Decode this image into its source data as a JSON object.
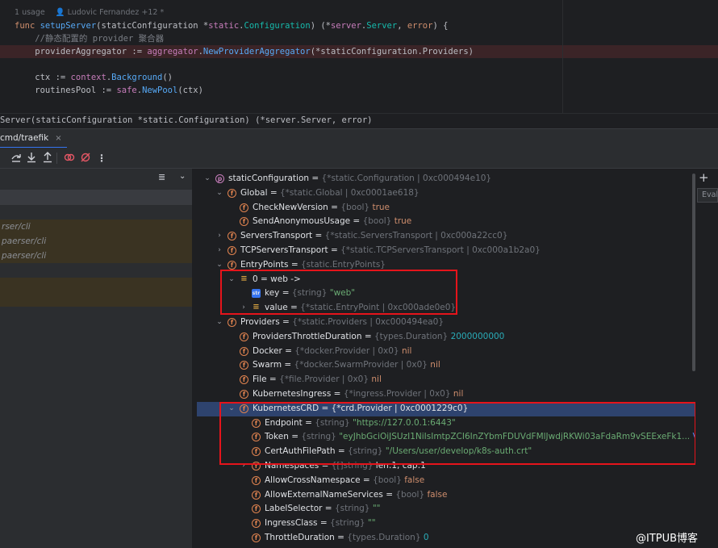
{
  "editor": {
    "hint_usage": "1 usage",
    "hint_author": "Ludovic Fernandez +12 *",
    "lines": [
      {
        "parts": [
          [
            "kw",
            "func "
          ],
          [
            "fn",
            "setupServer"
          ],
          [
            "pk",
            "(staticConfiguration *"
          ],
          [
            "pkg",
            "static"
          ],
          [
            "pk",
            "."
          ],
          [
            "ty",
            "Configuration"
          ],
          [
            "pk",
            ") (*"
          ],
          [
            "pkg",
            "server"
          ],
          [
            "pk",
            "."
          ],
          [
            "ty",
            "Server"
          ],
          [
            "pk",
            ", "
          ],
          [
            "kw",
            "error"
          ],
          [
            "pk",
            ") {"
          ]
        ]
      },
      {
        "parts": [
          [
            "cm",
            "    //静态配置的 provider 聚合器"
          ]
        ]
      },
      {
        "parts": [
          [
            "pk",
            "    providerAggregator := "
          ],
          [
            "pkg",
            "aggregator"
          ],
          [
            "pk",
            "."
          ],
          [
            "call",
            "NewProviderAggregator"
          ],
          [
            "pk",
            "(*staticConfiguration.Providers)"
          ]
        ]
      },
      {
        "parts": [
          [
            "pk",
            ""
          ]
        ]
      },
      {
        "parts": [
          [
            "pk",
            "    ctx := "
          ],
          [
            "pkg",
            "context"
          ],
          [
            "pk",
            "."
          ],
          [
            "call",
            "Background"
          ],
          [
            "pk",
            "()"
          ]
        ]
      },
      {
        "parts": [
          [
            "pk",
            "    routinesPool := "
          ],
          [
            "pkg",
            "safe"
          ],
          [
            "pk",
            "."
          ],
          [
            "call",
            "NewPool"
          ],
          [
            "pk",
            "(ctx)"
          ]
        ]
      }
    ]
  },
  "breadcrumb": "Server(staticConfiguration *static.Configuration) (*server.Server, error)",
  "debug_tab": {
    "label": "cmd/traefik",
    "close": "×"
  },
  "toolbar_icons": [
    "step-over-icon",
    "step-into-icon",
    "step-out-icon",
    "view-breakpoints-icon",
    "mute-breakpoints-icon",
    "more-icon"
  ],
  "frames": [
    {
      "label": "rser/cli"
    },
    {
      "label": "paerser/cli"
    },
    {
      "label": "paerser/cli"
    },
    {
      "label": ""
    },
    {
      "label": ""
    }
  ],
  "variables": [
    {
      "indent": 0,
      "arrow": "⌄",
      "icon": "p",
      "name": "staticConfiguration",
      "type": "{*static.Configuration | 0xc000494e10}",
      "value": "",
      "vclass": ""
    },
    {
      "indent": 1,
      "arrow": "⌄",
      "icon": "f",
      "name": "Global",
      "type": "{*static.Global | 0xc0001ae618}",
      "value": "",
      "vclass": ""
    },
    {
      "indent": 2,
      "arrow": "",
      "icon": "f",
      "name": "CheckNewVersion",
      "type": "{bool}",
      "value": "true",
      "vclass": "vkw"
    },
    {
      "indent": 2,
      "arrow": "",
      "icon": "f",
      "name": "SendAnonymousUsage",
      "type": "{bool}",
      "value": "true",
      "vclass": "vkw"
    },
    {
      "indent": 1,
      "arrow": "›",
      "icon": "f",
      "name": "ServersTransport",
      "type": "{*static.ServersTransport | 0xc000a22cc0}",
      "value": "",
      "vclass": ""
    },
    {
      "indent": 1,
      "arrow": "›",
      "icon": "f",
      "name": "TCPServersTransport",
      "type": "{*static.TCPServersTransport | 0xc000a1b2a0}",
      "value": "",
      "vclass": ""
    },
    {
      "indent": 1,
      "arrow": "⌄",
      "icon": "f",
      "name": "EntryPoints",
      "type": "{static.EntryPoints}",
      "value": "",
      "vclass": ""
    },
    {
      "indent": 2,
      "arrow": "⌄",
      "icon": "arr",
      "name": "0 = web ->",
      "type": "",
      "value": "",
      "vclass": "",
      "raw": true
    },
    {
      "indent": 3,
      "arrow": "",
      "icon": "str",
      "name": "key",
      "type": "{string}",
      "value": "\"web\"",
      "vclass": "vstr"
    },
    {
      "indent": 3,
      "arrow": "›",
      "icon": "arr",
      "name": "value",
      "type": "{*static.EntryPoint | 0xc000ade0e0}",
      "value": "",
      "vclass": ""
    },
    {
      "indent": 1,
      "arrow": "⌄",
      "icon": "f",
      "name": "Providers",
      "type": "{*static.Providers | 0xc000494ea0}",
      "value": "",
      "vclass": ""
    },
    {
      "indent": 2,
      "arrow": "",
      "icon": "f",
      "name": "ProvidersThrottleDuration",
      "type": "{types.Duration}",
      "value": "2000000000",
      "vclass": "vnum"
    },
    {
      "indent": 2,
      "arrow": "",
      "icon": "f",
      "name": "Docker",
      "type": "{*docker.Provider | 0x0}",
      "value": "nil",
      "vclass": "vkw"
    },
    {
      "indent": 2,
      "arrow": "",
      "icon": "f",
      "name": "Swarm",
      "type": "{*docker.SwarmProvider | 0x0}",
      "value": "nil",
      "vclass": "vkw"
    },
    {
      "indent": 2,
      "arrow": "",
      "icon": "f",
      "name": "File",
      "type": "{*file.Provider | 0x0}",
      "value": "nil",
      "vclass": "vkw"
    },
    {
      "indent": 2,
      "arrow": "",
      "icon": "f",
      "name": "KubernetesIngress",
      "type": "{*ingress.Provider | 0x0}",
      "value": "nil",
      "vclass": "vkw"
    },
    {
      "indent": 2,
      "arrow": "⌄",
      "icon": "f",
      "name": "KubernetesCRD = {*crd.Provider | 0xc0001229c0}",
      "type": "",
      "value": "",
      "vclass": "",
      "raw": true,
      "selected": true
    },
    {
      "indent": 3,
      "arrow": "",
      "icon": "f",
      "name": "Endpoint",
      "type": "{string}",
      "value": "\"https://127.0.0.1:6443\"",
      "vclass": "vstr"
    },
    {
      "indent": 3,
      "arrow": "",
      "icon": "f",
      "name": "Token",
      "type": "{string}",
      "value": "\"eyJhbGciOiJSUzI1NiIsImtpZCI6InZYbmFDUVdFMlJwdjRKWi03aFdaRm9vSEExeFk1...",
      "vclass": "vstr",
      "link": "View"
    },
    {
      "indent": 3,
      "arrow": "",
      "icon": "f",
      "name": "CertAuthFilePath",
      "type": "{string}",
      "value": "\"/Users/user/develop/k8s-auth.crt\"",
      "vclass": "vstr"
    },
    {
      "indent": 3,
      "arrow": "›",
      "icon": "f",
      "name": "Namespaces",
      "type": "{[]string}",
      "value": "len:1, cap:1",
      "vclass": "nm"
    },
    {
      "indent": 3,
      "arrow": "",
      "icon": "f",
      "name": "AllowCrossNamespace",
      "type": "{bool}",
      "value": "false",
      "vclass": "vkw"
    },
    {
      "indent": 3,
      "arrow": "",
      "icon": "f",
      "name": "AllowExternalNameServices",
      "type": "{bool}",
      "value": "false",
      "vclass": "vkw"
    },
    {
      "indent": 3,
      "arrow": "",
      "icon": "f",
      "name": "LabelSelector",
      "type": "{string}",
      "value": "\"\"",
      "vclass": "vstr"
    },
    {
      "indent": 3,
      "arrow": "",
      "icon": "f",
      "name": "IngressClass",
      "type": "{string}",
      "value": "\"\"",
      "vclass": "vstr"
    },
    {
      "indent": 3,
      "arrow": "",
      "icon": "f",
      "name": "ThrottleDuration",
      "type": "{types.Duration}",
      "value": "0",
      "vclass": "vnum"
    }
  ],
  "right_strip": {
    "add": "+",
    "eval": "Evaluate"
  },
  "watermark": "@ITPUB博客",
  "colors": {
    "background": "#1e1f22",
    "panel": "#2b2d30",
    "selection": "#2e436e",
    "highlight_box": "#e5141b",
    "accent": "#3574f0"
  }
}
